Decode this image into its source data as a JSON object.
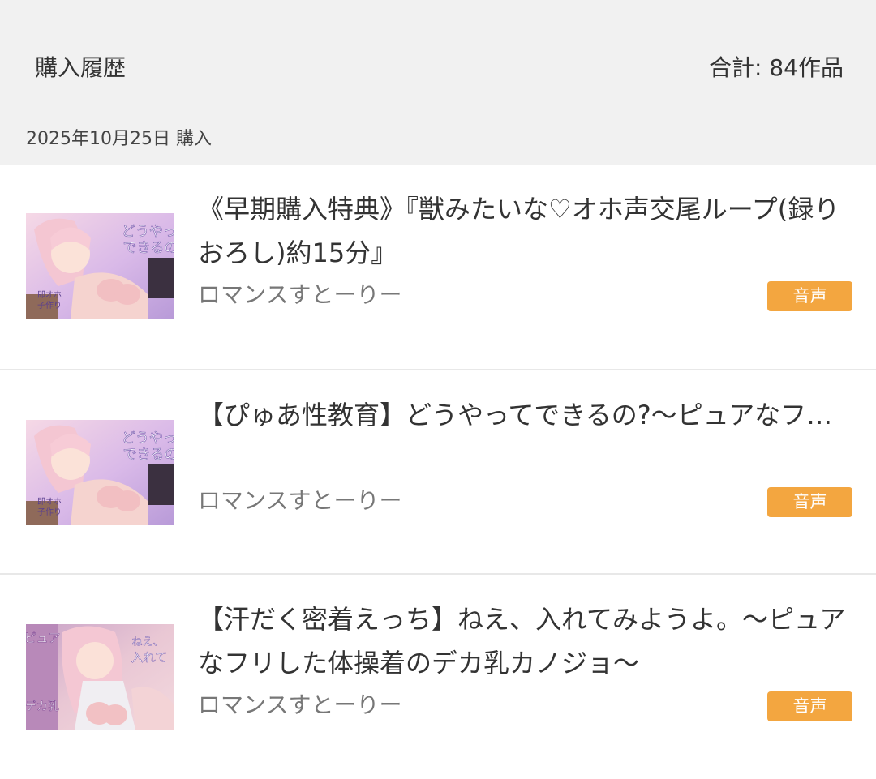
{
  "header": {
    "title": "購入履歴",
    "total": "合計: 84作品"
  },
  "group": {
    "date_heading": "2025年10月25日 購入"
  },
  "items": [
    {
      "title": "《早期購入特典》『獣みたいな♡オホ声交尾ループ(録りおろし)約15分』",
      "circle": "ロマンスすとーりー",
      "category": "音声",
      "thumb_text": [
        "どうやって",
        "できるの?",
        "即オホ",
        "子作り"
      ]
    },
    {
      "title": "【ぴゅあ性教育】どうやってできるの?〜ピュアなフリしたデカ乳カノジョと即オホ♡子作りホーム…",
      "circle": "ロマンスすとーりー",
      "category": "音声",
      "thumb_text": [
        "どうやって",
        "できるの?",
        "即オホ",
        "子作り"
      ]
    },
    {
      "title": "【汗だく密着えっち】ねえ、入れてみようよ。〜ピュアなフリした体操着のデカ乳カノジョ〜",
      "circle": "ロマンスすとーりー",
      "category": "音声",
      "thumb_text": [
        "ピュア",
        "デカ乳",
        "ねえ、",
        "入れて"
      ]
    }
  ],
  "colors": {
    "header_bg": "#f1f1f1",
    "badge": "#f3a640",
    "divider": "#e8e8e8"
  }
}
